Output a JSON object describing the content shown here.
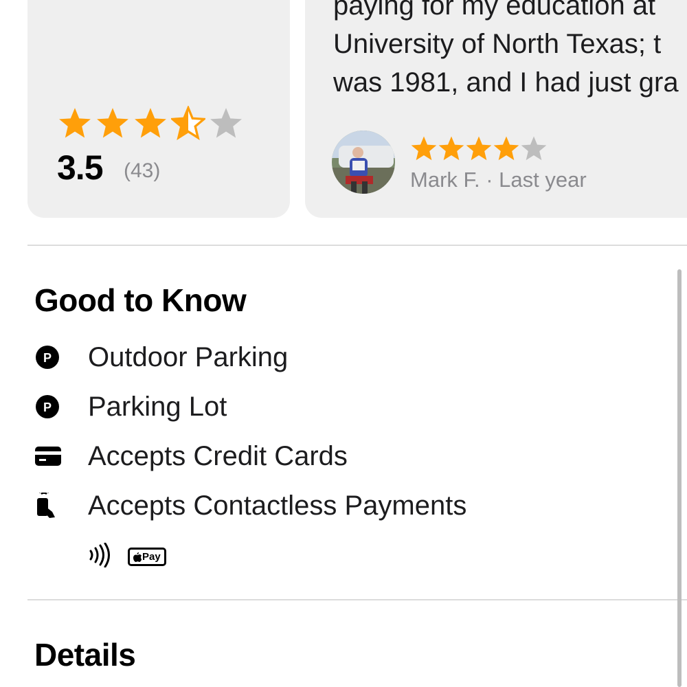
{
  "ratings": {
    "average": "3.5",
    "count": "(43)",
    "stars_value": 3.5,
    "stars_max": 5,
    "star_color": "#ff9f0a",
    "empty_star_color": "#bdbdbd"
  },
  "review": {
    "lines": [
      "paying for my education at",
      "University of North Texas; t",
      "was 1981, and I had just gra"
    ],
    "stars_value": 4,
    "stars_max": 5,
    "reviewer": "Mark F. · Last year"
  },
  "good_to_know": {
    "title": "Good to Know",
    "items": [
      {
        "icon": "parking-icon",
        "label": "Outdoor Parking"
      },
      {
        "icon": "parking-icon",
        "label": "Parking Lot"
      },
      {
        "icon": "credit-card-icon",
        "label": "Accepts Credit Cards"
      },
      {
        "icon": "contactless-payment-icon",
        "label": "Accepts Contactless Payments"
      }
    ],
    "sub_icons": [
      "nfc-icon",
      "apple-pay-icon"
    ],
    "apple_pay_text": "Pay"
  },
  "details": {
    "title": "Details"
  }
}
